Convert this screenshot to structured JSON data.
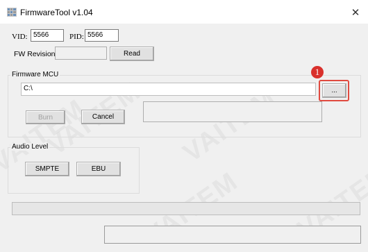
{
  "window": {
    "title": "FirmwareTool v1.04",
    "app_icon": "grid-app-icon",
    "close_icon": "close-icon",
    "close_glyph": "✕"
  },
  "ids": {
    "vid_label": "VID:",
    "vid_value": "5566",
    "pid_label": "PID:",
    "pid_value": "5566"
  },
  "fw_revision": {
    "label": "FW Revision:",
    "value": "",
    "read_label": "Read"
  },
  "firmware_mcu": {
    "legend": "Firmware MCU",
    "path_value": "C:\\",
    "browse_label": "...",
    "burn_label": "Burn",
    "cancel_label": "Cancel",
    "status_value": ""
  },
  "audio_level": {
    "legend": "Audio Level",
    "smpte_label": "SMPTE",
    "ebu_label": "EBU"
  },
  "annotation": {
    "marker_label": "1",
    "highlight_color": "#e04a3f"
  },
  "watermark": {
    "text": "VAITEM"
  },
  "bottom_status": {
    "value": ""
  }
}
